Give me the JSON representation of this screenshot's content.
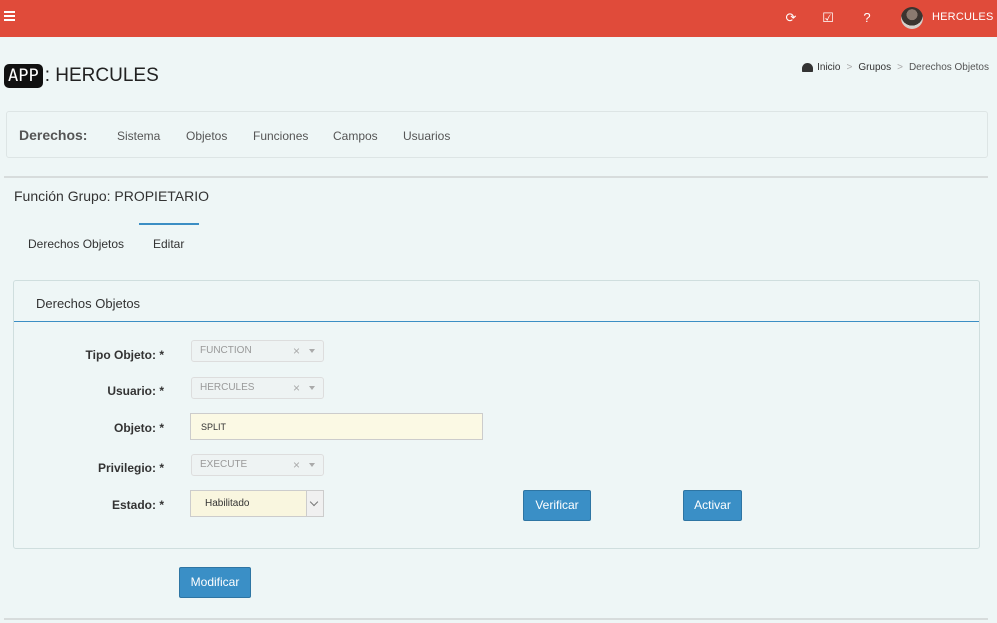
{
  "topbar": {
    "user": "HERCULES",
    "icons": [
      "refresh-icon",
      "check-square-icon",
      "question-circle-icon"
    ]
  },
  "header": {
    "brand_badge": "APP",
    "title": ": HERCULES"
  },
  "breadcrumb": {
    "home": "Inicio",
    "grupos": "Grupos",
    "current": "Derechos Objetos",
    "separator": ">"
  },
  "derechos_nav": {
    "title": "Derechos:",
    "items": [
      "Sistema",
      "Objetos",
      "Funciones",
      "Campos",
      "Usuarios"
    ]
  },
  "page": {
    "heading": "Función Grupo: PROPIETARIO"
  },
  "tabs": [
    "Derechos Objetos",
    "Editar"
  ],
  "panel": {
    "title": "Derechos Objetos",
    "fields": {
      "tipo_objeto": {
        "label": "Tipo Objeto: *",
        "value": "FUNCTION"
      },
      "usuario": {
        "label": "Usuario: *",
        "value": "HERCULES"
      },
      "objeto": {
        "label": "Objeto: *",
        "value": "SPLIT"
      },
      "privilegio": {
        "label": "Privilegio: *",
        "value": "EXECUTE"
      },
      "estado": {
        "label": "Estado: *",
        "value": "Habilitado"
      }
    },
    "buttons": {
      "verificar": "Verificar",
      "activar": "Activar"
    },
    "clear_glyph": "×"
  },
  "actions": {
    "modificar": "Modificar"
  },
  "colors": {
    "topbar": "#e04b3a",
    "primary": "#3a8fc6",
    "background": "#eef6f6"
  }
}
